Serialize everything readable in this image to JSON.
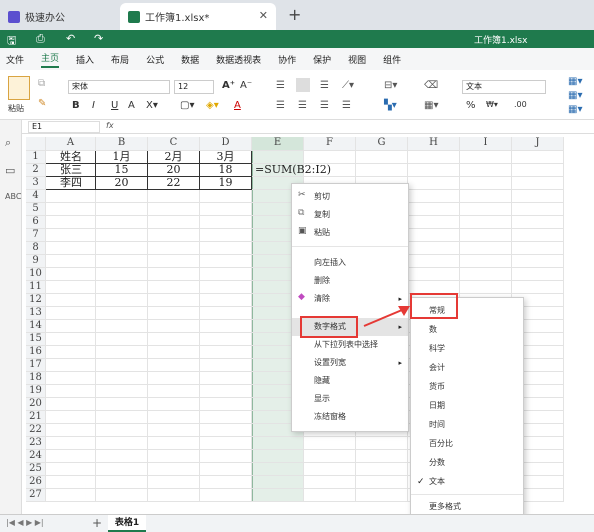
{
  "tabs": [
    {
      "label": "极速办公"
    },
    {
      "label": "工作簿1.xlsx*"
    }
  ],
  "quickbar": {
    "filename": "工作簿1.xlsx"
  },
  "menu": [
    "文件",
    "主页",
    "插入",
    "布局",
    "公式",
    "数据",
    "数据透视表",
    "协作",
    "保护",
    "视图",
    "组件"
  ],
  "ribbon": {
    "paste": "粘贴",
    "font": "宋体",
    "size": "12",
    "numformat": "文本",
    "bold": "B",
    "italic": "I",
    "underline": "U",
    "strike": "A",
    "fontcolor": "A",
    "grow": "A⁺",
    "shrink": "A⁻",
    "percent": "%"
  },
  "formula_bar": {
    "cellref": "E1",
    "fx": "fx"
  },
  "columns": [
    "A",
    "B",
    "C",
    "D",
    "E",
    "F",
    "G",
    "H",
    "I",
    "J"
  ],
  "rows": [
    "1",
    "2",
    "3",
    "4",
    "5",
    "6",
    "7",
    "8",
    "9",
    "10",
    "11",
    "12",
    "13",
    "14",
    "15",
    "16",
    "17",
    "18",
    "19",
    "20",
    "21",
    "22",
    "23",
    "24",
    "25",
    "26",
    "27"
  ],
  "cells": {
    "A1": "姓名",
    "B1": "1月",
    "C1": "2月",
    "D1": "3月",
    "A2": "张三",
    "B2": "15",
    "C2": "20",
    "D2": "18",
    "A3": "李四",
    "B3": "20",
    "C3": "22",
    "D3": "19",
    "E2": "=SUM(B2:I2)"
  },
  "context_menu": [
    "剪切",
    "复制",
    "粘贴",
    "向左插入",
    "删除",
    "清除",
    "数字格式",
    "从下拉列表中选择",
    "设置列宽",
    "隐藏",
    "显示",
    "冻结窗格"
  ],
  "submenu": [
    "常规",
    "数",
    "科学",
    "会计",
    "货币",
    "日期",
    "时间",
    "百分比",
    "分数",
    "文本",
    "更多格式"
  ],
  "submenu_checked": "文本",
  "sheet_tab": "表格1",
  "colors": {
    "brand": "#1f7a4d",
    "highlight": "#e53935"
  }
}
